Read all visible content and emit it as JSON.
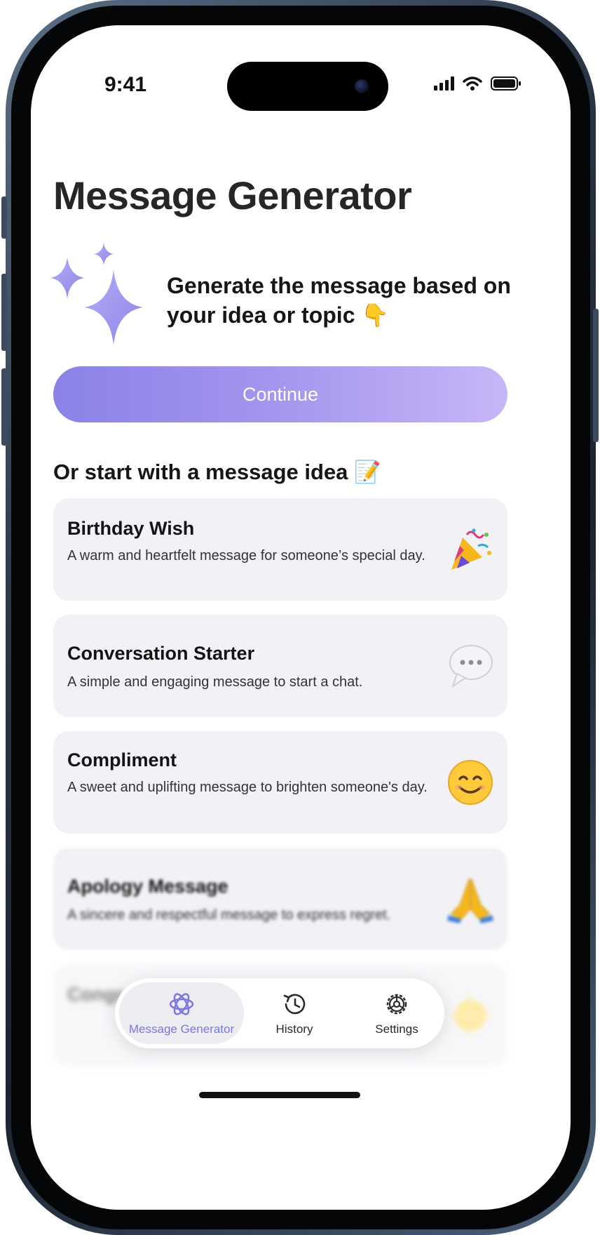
{
  "status": {
    "time": "9:41"
  },
  "page": {
    "title": "Message Generator"
  },
  "hero": {
    "text": "Generate the message based on your idea or topic 👇",
    "icon": "sparkles-icon",
    "accent": "#a39cf0"
  },
  "continue_label": "Continue",
  "section_title": "Or start with a message idea 📝",
  "ideas": [
    {
      "title": "Birthday Wish",
      "desc": "A warm and heartfelt message for someone’s special day.",
      "icon": "party-popper-icon"
    },
    {
      "title": "Conversation Starter",
      "desc": "A simple and engaging message to start a chat.",
      "icon": "speech-bubble-icon"
    },
    {
      "title": "Compliment",
      "desc": "A sweet and uplifting message to brighten someone's day.",
      "icon": "smiling-face-icon"
    },
    {
      "title": "Apology Message",
      "desc": "A sincere and respectful message to express regret.",
      "icon": "folded-hands-icon"
    },
    {
      "title": "Congr",
      "desc": "",
      "icon": "sparkle-star-icon"
    }
  ],
  "tabs": [
    {
      "label": "Message Generator",
      "icon": "atom-icon",
      "active": true
    },
    {
      "label": "History",
      "icon": "history-icon",
      "active": false
    },
    {
      "label": "Settings",
      "icon": "settings-icon",
      "active": false
    }
  ],
  "colors": {
    "accent": "#7d77e0",
    "card_bg": "#f2f2f6"
  }
}
